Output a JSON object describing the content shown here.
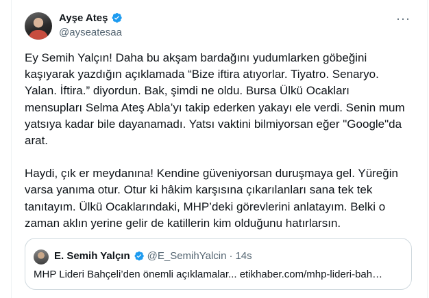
{
  "tweet": {
    "author_name": "Ayşe Ateş",
    "author_handle": "@ayseatesaa",
    "verified": true,
    "more_label": "···",
    "paragraph_1": "Ey Semih Yalçın! Daha bu akşam bardağını yudumlarken göbeğini\nkaşıyarak yazdığın açıklamada “Bize iftira atıyorlar. Tiyatro. Senaryo.\nYalan. İftira.” diyordun. Bak, şimdi ne oldu. Bursa Ülkü Ocakları\nmensupları Selma Ateş Abla’yı takip ederken yakayı ele verdi. Senin mum\nyatsıya kadar bile dayanamadı. Yatsı vaktini bilmiyorsan eğer \"Google\"da\narat.",
    "paragraph_2": "Haydi, çık er meydanına! Kendine güveniyorsan duruşmaya gel. Yüreğin\nvarsa yanıma otur. Otur ki hâkim karşısına çıkarılanları sana tek tek\ntanıtayım. Ülkü Ocaklarındaki, MHP’deki görevlerini anlatayım. Belki o\nzaman aklın yerine gelir de katillerin kim olduğunu hatırlarsın."
  },
  "quoted": {
    "author_name": "E. Semih Yalçın",
    "author_handle": "@E_SemihYalcin",
    "separator": "·",
    "time": "14s",
    "text": "MHP Lideri Bahçeli’den önemli açıklamalar... etikhaber.com/mhp-lideri-bah…"
  },
  "colors": {
    "verified_blue": "#1d9bf0",
    "secondary_text": "#536471",
    "border": "#cfd9de"
  },
  "icons": {
    "verified": "verified-badge-icon",
    "more": "more-options-icon"
  }
}
